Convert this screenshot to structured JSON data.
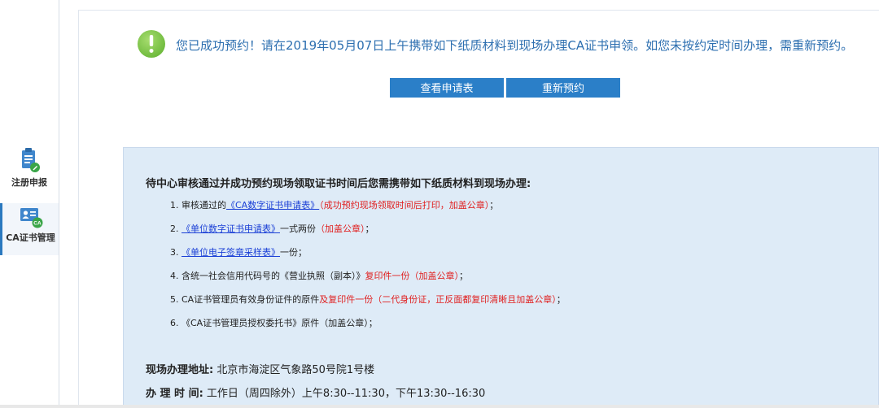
{
  "sidebar": {
    "items": [
      {
        "label": "注册申报"
      },
      {
        "label": "CA证书管理",
        "badge": "CA"
      }
    ]
  },
  "notice": {
    "message": "您已成功预约！请在2019年05月07日上午携带如下纸质材料到现场办理CA证书申领。如您未按约定时间办理，需重新预约。"
  },
  "actions": {
    "view_label": "查看申请表",
    "reapply_label": "重新预约"
  },
  "materials": {
    "title": "待中心审核通过并成功预约现场领取证书时间后您需携带如下纸质材料到现场办理:",
    "items": [
      {
        "prefix": "1. 审核通过的",
        "link": "《CA数字证书申请表》",
        "red": "（成功预约现场领取时间后打印，加盖公章）",
        "suffix": "；"
      },
      {
        "prefix": "2. ",
        "link": "《单位数字证书申请表》",
        "plain": "一式两份",
        "red": "（加盖公章）",
        "suffix": "；"
      },
      {
        "prefix": "3. ",
        "link": "《单位电子签章采样表》",
        "suffix": "一份；"
      },
      {
        "prefix": "4. 含统一社会信用代码号的《营业执照（副本）》",
        "red": "复印件一份（加盖公章）",
        "suffix": "；"
      },
      {
        "prefix": "5. CA证书管理员有效身份证件的原件",
        "red": "及复印件一份（二代身份证，正反面都复印清晰且加盖公章）",
        "suffix": "；"
      },
      {
        "prefix": "6. 《CA证书管理员授权委托书》原件（加盖公章）；"
      }
    ]
  },
  "location": {
    "address_label": "现场办理地址:",
    "address_value": "北京市海淀区气象路50号院1号楼",
    "hours_label": "办 理 时 间:",
    "hours_value": "工作日（周四除外）上午8:30--11:30，下午13:30--16:30"
  },
  "colors": {
    "accent": "#2b7fc8",
    "success_green": "#7cc24a",
    "link_blue": "#1a3fd6",
    "warning_red": "#e02020",
    "panel_bg": "#deebf7"
  }
}
